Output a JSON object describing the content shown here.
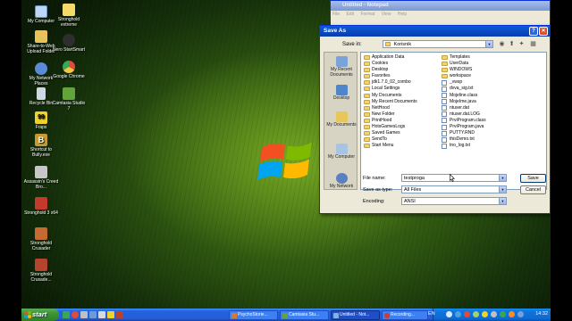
{
  "desktop": {
    "icons": [
      {
        "label": "My Computer",
        "color": "#bcd6f5"
      },
      {
        "label": "Stronghold extreme",
        "color": "#f5d96b"
      },
      {
        "label": "Share-to-Web Upload Folder",
        "color": "#e7c25a"
      },
      {
        "label": "Nero StartSmart",
        "color": "#2e2e2e"
      },
      {
        "label": "My Network Places",
        "color": "#5b8bd6"
      },
      {
        "label": "Google Chrome",
        "color": "#e24a3a"
      },
      {
        "label": "Recycle Bin",
        "color": "#cfd8e0"
      },
      {
        "label": "Camtasia Studio 7",
        "color": "#63a33b"
      },
      {
        "label": "Fraps",
        "color": "#f0d02a"
      },
      {
        "label": "Shortcut to Bully.exe",
        "color": "#c79a2f"
      },
      {
        "label": "Assassin's Creed Bro...",
        "color": "#c7c7c7"
      },
      {
        "label": "Stronghold 3 x64",
        "color": "#c33a2a"
      },
      {
        "label": "Stronghold Crusader",
        "color": "#c56a30"
      },
      {
        "label": "Stronghold Crusade...",
        "color": "#b4442e"
      }
    ]
  },
  "notepad": {
    "title": "Untitled - Notepad",
    "menu": [
      "File",
      "Edit",
      "Format",
      "View",
      "Help"
    ]
  },
  "dialog": {
    "title": "Save As",
    "help_glyph": "?",
    "close_glyph": "✕",
    "save_in_label": "Save in:",
    "save_in_value": "Korisnik",
    "places": [
      {
        "label": "My Recent Documents",
        "color": "#7aa3d9"
      },
      {
        "label": "Desktop",
        "color": "#4f86c9"
      },
      {
        "label": "My Documents",
        "color": "#e8c65a"
      },
      {
        "label": "My Computer",
        "color": "#a8c4e4"
      },
      {
        "label": "My Network",
        "color": "#5b7fbf"
      }
    ],
    "files_col1": [
      {
        "name": "Application Data",
        "type": "folder"
      },
      {
        "name": "Cookies",
        "type": "folder"
      },
      {
        "name": "Desktop",
        "type": "folder"
      },
      {
        "name": "Favorites",
        "type": "folder"
      },
      {
        "name": "jdk1.7.0_02_combo",
        "type": "folder"
      },
      {
        "name": "Local Settings",
        "type": "folder"
      },
      {
        "name": "My Documents",
        "type": "folder"
      },
      {
        "name": "My Recent Documents",
        "type": "folder"
      },
      {
        "name": "NetHood",
        "type": "folder"
      },
      {
        "name": "New Folder",
        "type": "folder"
      },
      {
        "name": "PrintHood",
        "type": "folder"
      },
      {
        "name": "HotsGamesLogs",
        "type": "folder"
      },
      {
        "name": "Saved Games",
        "type": "folder"
      },
      {
        "name": "SendTo",
        "type": "folder"
      },
      {
        "name": "Start Menu",
        "type": "folder"
      }
    ],
    "files_col2": [
      {
        "name": "Templates",
        "type": "folder"
      },
      {
        "name": "UserData",
        "type": "folder"
      },
      {
        "name": "WINDOWS",
        "type": "folder"
      },
      {
        "name": "workspace",
        "type": "folder"
      },
      {
        "name": "_vwsp",
        "type": "file"
      },
      {
        "name": "dvva_sig.txt",
        "type": "file"
      },
      {
        "name": "Mojeline.class",
        "type": "file"
      },
      {
        "name": "MojeIme.java",
        "type": "file"
      },
      {
        "name": "ntuser.dat",
        "type": "file"
      },
      {
        "name": "ntuser.dat.LOG",
        "type": "file"
      },
      {
        "name": "PrviProgram.class",
        "type": "file"
      },
      {
        "name": "PrviProgram.java",
        "type": "file"
      },
      {
        "name": "PUTTY.RND",
        "type": "file"
      },
      {
        "name": "thisDemo.txt",
        "type": "file"
      },
      {
        "name": "tno_log.txt",
        "type": "file"
      }
    ],
    "file_name_label": "File name:",
    "file_name_value": "testproga",
    "save_type_label": "Save as type:",
    "save_type_value": "All Files",
    "encoding_label": "Encoding:",
    "encoding_value": "ANSI",
    "save_button": "Save",
    "cancel_button": "Cancel"
  },
  "taskbar": {
    "start_label": "start",
    "tasks": [
      {
        "label": "PsychoStorie...",
        "color": "#d67a2e",
        "active": false
      },
      {
        "label": "Camtasia Stu...",
        "color": "#63a33b",
        "active": false
      },
      {
        "label": "Untitled - Not...",
        "color": "#7fb3e8",
        "active": true
      },
      {
        "label": "Recording...",
        "color": "#d33a2a",
        "active": false
      }
    ],
    "lang": "EN",
    "clock": "14:32"
  }
}
